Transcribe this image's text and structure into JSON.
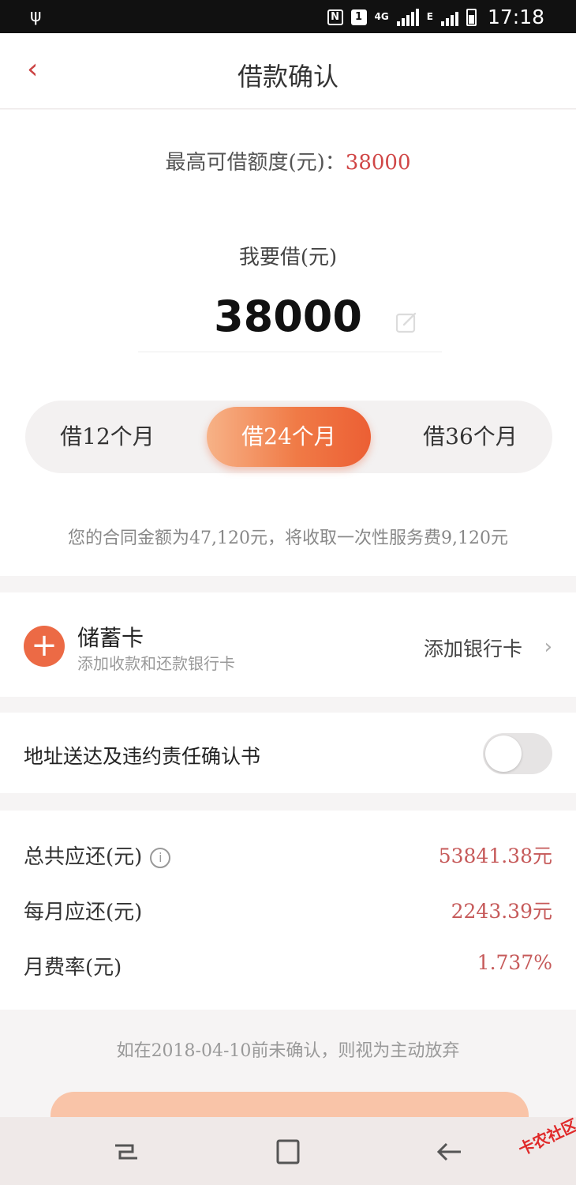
{
  "status_bar": {
    "time": "17:18",
    "sim_slot": "1",
    "network": "4G",
    "network_2": "E"
  },
  "header": {
    "title": "借款确认"
  },
  "loan": {
    "max_label": "最高可借额度(元)：",
    "max_amount": "38000",
    "borrow_label": "我要借(元)",
    "amount": "38000",
    "terms": [
      {
        "label": "借12个月",
        "selected": false
      },
      {
        "label": "借24个月",
        "selected": true
      },
      {
        "label": "借36个月",
        "selected": false
      }
    ],
    "contract_note": "您的合同金额为47,120元，将收取一次性服务费9,120元"
  },
  "bank_card": {
    "title": "储蓄卡",
    "subtitle": "添加收款和还款银行卡",
    "action": "添加银行卡"
  },
  "agreement": {
    "label": "地址送达及违约责任确认书",
    "enabled": false
  },
  "summary": {
    "rows": [
      {
        "label": "总共应还(元)",
        "value": "53841.38元"
      },
      {
        "label": "每月应还(元)",
        "value": "2243.39元"
      },
      {
        "label": "月费率(元)",
        "value": "1.737%"
      }
    ]
  },
  "deadline_note": "如在2018-04-10前未确认，则视为主动放弃",
  "watermark": "卡农社区",
  "colors": {
    "accent": "#ec5f34",
    "value_text": "#c65a5a"
  }
}
